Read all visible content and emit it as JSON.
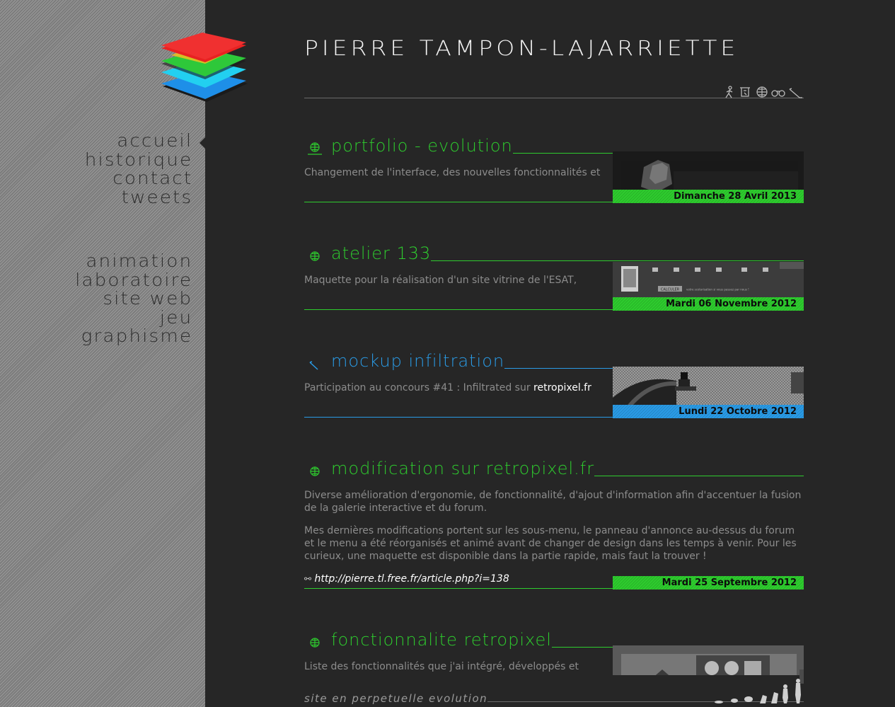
{
  "site": {
    "title": "PIERRE TAMPON-LAJARRIETTE",
    "footer": "site en perpetuelle evolution"
  },
  "nav": {
    "main": [
      "accueil",
      "historique",
      "contact",
      "tweets"
    ],
    "categories": [
      "animation",
      "laboratoire",
      "site web",
      "jeu",
      "graphisme"
    ],
    "active": "accueil"
  },
  "colors": {
    "green": "#2ecc2e",
    "blue": "#2a9be6",
    "background": "#262626",
    "sidebar": "#8a8a8a"
  },
  "header_icons": [
    "animation-icon",
    "laboratoire-icon",
    "site-web-icon",
    "jeu-icon",
    "graphisme-icon"
  ],
  "posts": [
    {
      "title": "portfolio - evolution",
      "category_icon": "globe-icon",
      "color": "green",
      "text": "Changement de l'interface, des nouvelles fonctionnalités et",
      "date": "Dimanche 28 Avril 2013"
    },
    {
      "title": "atelier 133",
      "category_icon": "globe-icon",
      "color": "green",
      "text": "Maquette pour la réalisation d'un site vitrine de l'ESAT,",
      "date": "Mardi 06 Novembre 2012"
    },
    {
      "title": "mockup infiltration",
      "category_icon": "pencil-icon",
      "color": "blue",
      "text": "Participation au concours #41 : Infiltrated sur ",
      "text_link": "retropixel.fr",
      "date": "Lundi 22 Octobre 2012"
    },
    {
      "title": "modification sur retropixel.fr",
      "category_icon": "globe-icon",
      "color": "green",
      "paragraph1": "Diverse amélioration d'ergonomie, de fonctionnalité, d'ajout d'information afin d'accentuer la fusion de la galerie interactive et du forum.",
      "paragraph2": "Mes dernières modifications portent sur les sous-menu, le panneau d'annonce au-dessus du forum et le menu a été réorganisés et animé avant de changer de design dans les temps à venir. Pour les curieux, une maquette est disponible dans la partie rapide, mais faut la trouver !",
      "link": "http://pierre.tl.free.fr/article.php?i=138",
      "date": "Mardi 25 Septembre 2012"
    },
    {
      "title": "fonctionnalite retropixel",
      "category_icon": "globe-icon",
      "color": "green",
      "text": "Liste des fonctionnalités que j'ai intégré, développés et"
    }
  ],
  "thumbnail2_button": "CALCULER",
  "thumbnail2_caption": "votre scolarisation si vous passez par nous !"
}
